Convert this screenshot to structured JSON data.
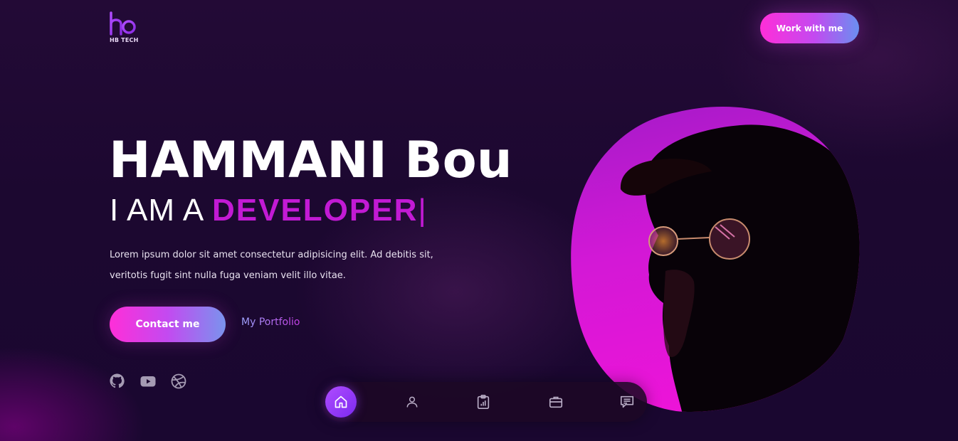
{
  "brand": {
    "logo_text": "HB TECH",
    "logo_icon": "hb-logo-icon"
  },
  "header": {
    "cta_label": "Work with me"
  },
  "hero": {
    "name": "HAMMANI Bou",
    "role_prefix": "I AM A",
    "role_word": "DEVELOPER",
    "cursor": "|",
    "description": "Lorem ipsum dolor sit amet consectetur adipisicing elit. Ad debitis sit, veritotis fugit sint nulla fuga veniam velit illo vitae.",
    "primary_button": "Contact me",
    "secondary_link": "My Portfolio"
  },
  "social": [
    {
      "name": "github",
      "icon": "github-icon"
    },
    {
      "name": "youtube",
      "icon": "youtube-icon"
    },
    {
      "name": "dribbble",
      "icon": "dribbble-icon"
    }
  ],
  "bottom_nav": [
    {
      "name": "home",
      "icon": "home-icon",
      "active": true
    },
    {
      "name": "about",
      "icon": "user-icon",
      "active": false
    },
    {
      "name": "skills",
      "icon": "clipboard-chart-icon",
      "active": false
    },
    {
      "name": "portfolio",
      "icon": "briefcase-icon",
      "active": false
    },
    {
      "name": "contact",
      "icon": "message-icon",
      "active": false
    }
  ],
  "colors": {
    "background": "#1d0830",
    "accent_magenta": "#c21ad4",
    "button_gradient_start": "#ff2ed8",
    "button_gradient_end": "#7a93ee",
    "nav_active": "#9b3cff"
  }
}
